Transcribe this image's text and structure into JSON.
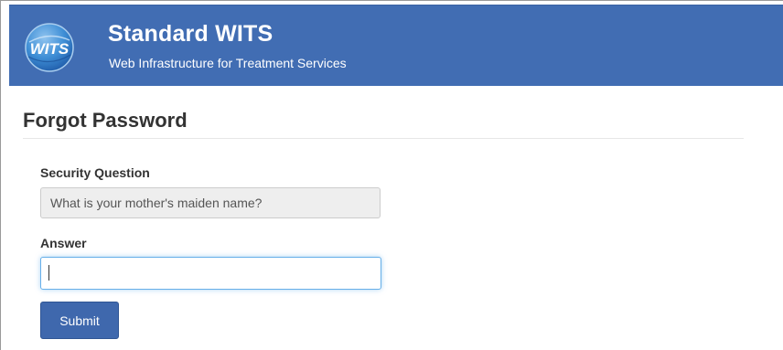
{
  "header": {
    "logo_text": "WITS",
    "title": "Standard WITS",
    "subtitle": "Web Infrastructure for Treatment Services",
    "background_color": "#416db3"
  },
  "page": {
    "title": "Forgot Password"
  },
  "form": {
    "security_question_label": "Security Question",
    "security_question_value": "What is your mother's maiden name?",
    "answer_label": "Answer",
    "answer_value": "",
    "submit_label": "Submit",
    "submit_color": "#3f68ad"
  }
}
